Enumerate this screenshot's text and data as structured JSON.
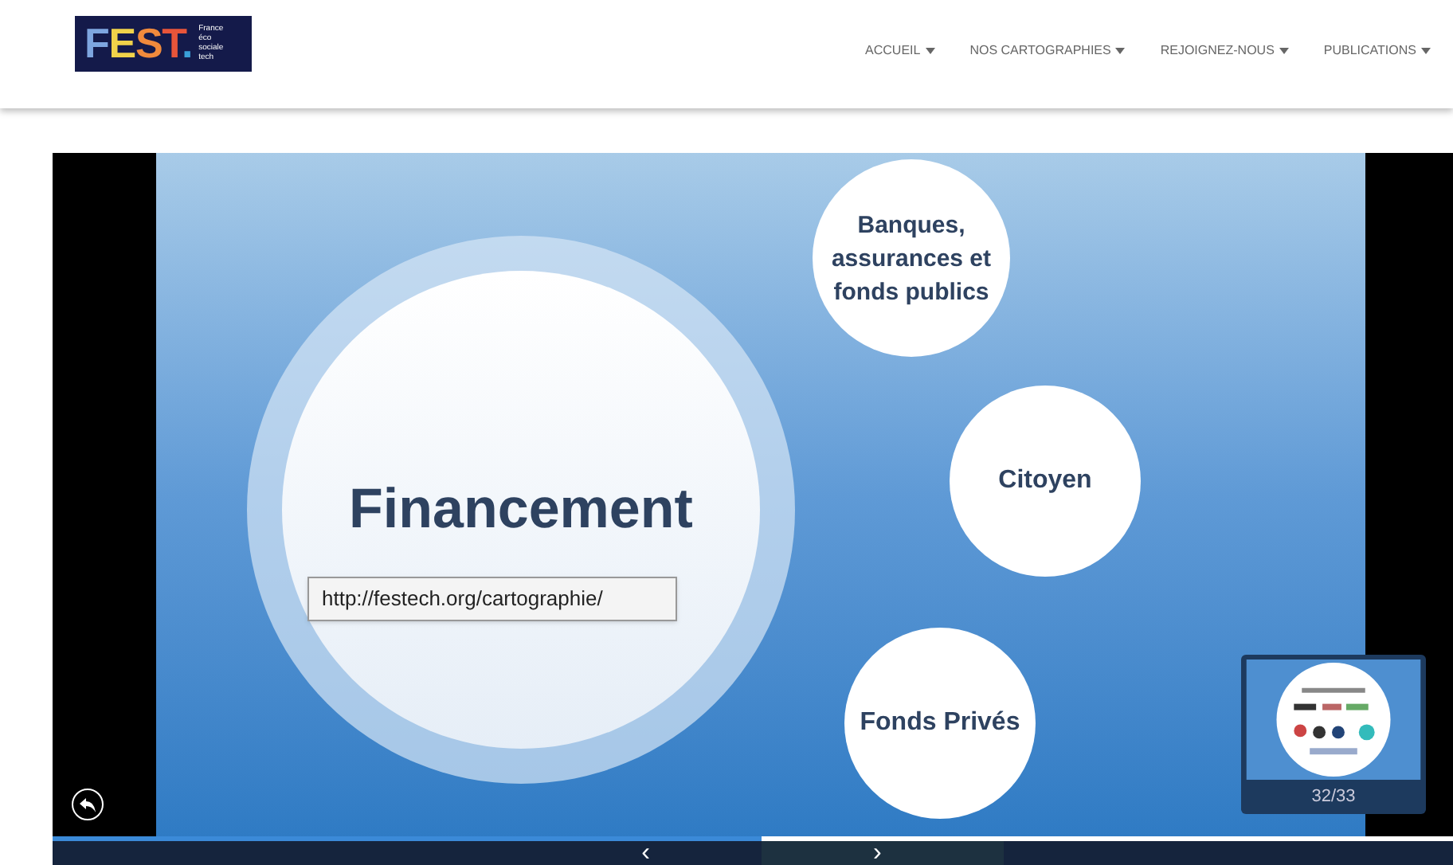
{
  "logo": {
    "text": "FEST.",
    "tagline": "France éco sociale tech"
  },
  "nav": [
    {
      "label": "ACCUEIL"
    },
    {
      "label": "NOS CARTOGRAPHIES"
    },
    {
      "label": "REJOIGNEZ-NOUS"
    },
    {
      "label": "PUBLICATIONS"
    }
  ],
  "slide": {
    "main_topic": "Financement",
    "bubbles": [
      {
        "label": "Banques, assurances et fonds publics"
      },
      {
        "label": "Citoyen"
      },
      {
        "label": "Fonds Privés"
      }
    ],
    "tooltip": "http://festech.org/cartographie/"
  },
  "thumbnail": {
    "counter": "32/33"
  },
  "controls": {
    "prev": "‹",
    "next": "›"
  }
}
